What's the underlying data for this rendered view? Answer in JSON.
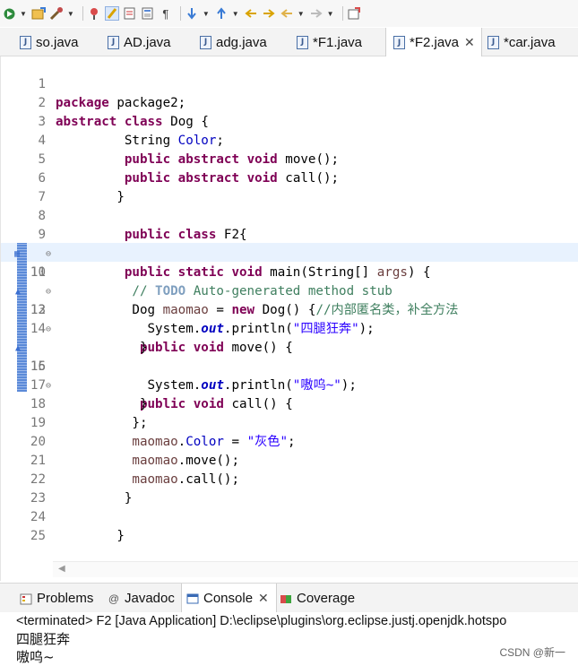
{
  "toolbar": {
    "icons": [
      "debug-run-icon",
      "new-project-icon",
      "tools-icon",
      "search-icon",
      "highlight-icon",
      "task-icon",
      "layout-icon",
      "pilcrow-icon",
      "annotation-next-icon",
      "annotation-prev-icon",
      "nav-back-icon",
      "nav-forward-icon",
      "back-icon",
      "forward-icon",
      "pin-editor-icon"
    ]
  },
  "tabs": [
    {
      "label": "so.java",
      "modified": false,
      "active": false
    },
    {
      "label": "AD.java",
      "modified": false,
      "active": false
    },
    {
      "label": "adg.java",
      "modified": false,
      "active": false
    },
    {
      "label": "*F1.java",
      "modified": true,
      "active": false
    },
    {
      "label": "*F2.java",
      "modified": true,
      "active": true
    },
    {
      "label": "*car.java",
      "modified": true,
      "active": false
    }
  ],
  "editor": {
    "lines": [
      {
        "n": "1",
        "text": "package package2;"
      },
      {
        "n": "2",
        "text": "abstract class Dog {"
      },
      {
        "n": "3",
        "text": "         String Color;"
      },
      {
        "n": "4",
        "text": "         public abstract void move();"
      },
      {
        "n": "5",
        "text": "         public abstract void call();"
      },
      {
        "n": "6",
        "text": "        }"
      },
      {
        "n": "7",
        "text": ""
      },
      {
        "n": "8",
        "text": "         public class F2{"
      },
      {
        "n": "9",
        "text": "         public static void main(String[] args) {"
      },
      {
        "n": "10",
        "text": "          // TODO Auto-generated method stub"
      },
      {
        "n": "11",
        "text": "          Dog maomao = new Dog() {//内部匿名类，补全方法"
      },
      {
        "n": "12",
        "text": "           public void move() {"
      },
      {
        "n": "13",
        "text": "            System.out.println(\"四腿狂奔\");"
      },
      {
        "n": "14",
        "text": "           }"
      },
      {
        "n": "15",
        "text": "           public void call() {"
      },
      {
        "n": "16",
        "text": "            System.out.println(\"嗷呜~\");"
      },
      {
        "n": "17",
        "text": "           }"
      },
      {
        "n": "18",
        "text": "          };"
      },
      {
        "n": "19",
        "text": "          maomao.Color = \"灰色\";"
      },
      {
        "n": "20",
        "text": "          maomao.move();"
      },
      {
        "n": "21",
        "text": "          maomao.call();"
      },
      {
        "n": "22",
        "text": "         }"
      },
      {
        "n": "23",
        "text": ""
      },
      {
        "n": "24",
        "text": "        }"
      },
      {
        "n": "25",
        "text": ""
      }
    ]
  },
  "console": {
    "tabs": [
      {
        "label": "Problems",
        "icon": "problems-icon"
      },
      {
        "label": "Javadoc",
        "icon": "at-icon"
      },
      {
        "label": "Console",
        "icon": "console-icon",
        "active": true
      },
      {
        "label": "Coverage",
        "icon": "coverage-icon"
      }
    ],
    "status": "<terminated> F2 [Java Application] D:\\eclipse\\plugins\\org.eclipse.justj.openjdk.hotspo",
    "output": [
      "四腿狂奔",
      "嗷呜~"
    ]
  },
  "watermark": "CSDN @新一"
}
